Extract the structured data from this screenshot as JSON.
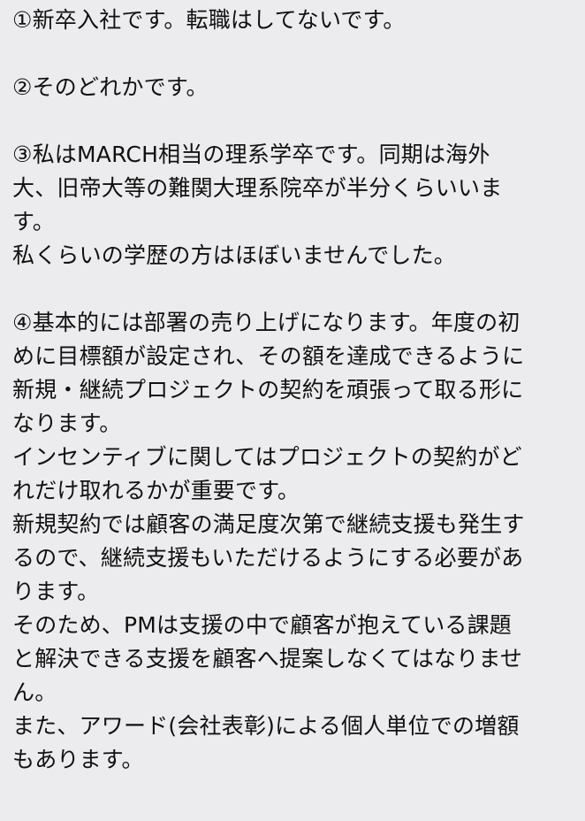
{
  "answers": [
    {
      "lines": [
        "①新卒入社です。転職はしてないです。"
      ]
    },
    {
      "lines": [
        "②そのどれかです。"
      ]
    },
    {
      "lines": [
        "③私はMARCH相当の理系学卒です。同期は海外",
        "大、旧帝大等の難関大理系院卒が半分くらいいま",
        "す。",
        "私くらいの学歴の方はほぼいませんでした。"
      ]
    },
    {
      "lines": [
        "④基本的には部署の売り上げになります。年度の初",
        "めに目標額が設定され、その額を達成できるように",
        "新規・継続プロジェクトの契約を頑張って取る形に",
        "なります。",
        "インセンティブに関してはプロジェクトの契約がど",
        "れだけ取れるかが重要です。",
        "新規契約では顧客の満足度次第で継続支援も発生す",
        "るので、継続支援もいただけるようにする必要があ",
        "ります。",
        "そのため、PMは支援の中で顧客が抱えている課題",
        "と解決できる支援を顧客へ提案しなくてはなりませ",
        "ん。",
        "また、アワード(会社表彰)による個人単位での増額",
        "もあります。"
      ]
    }
  ]
}
